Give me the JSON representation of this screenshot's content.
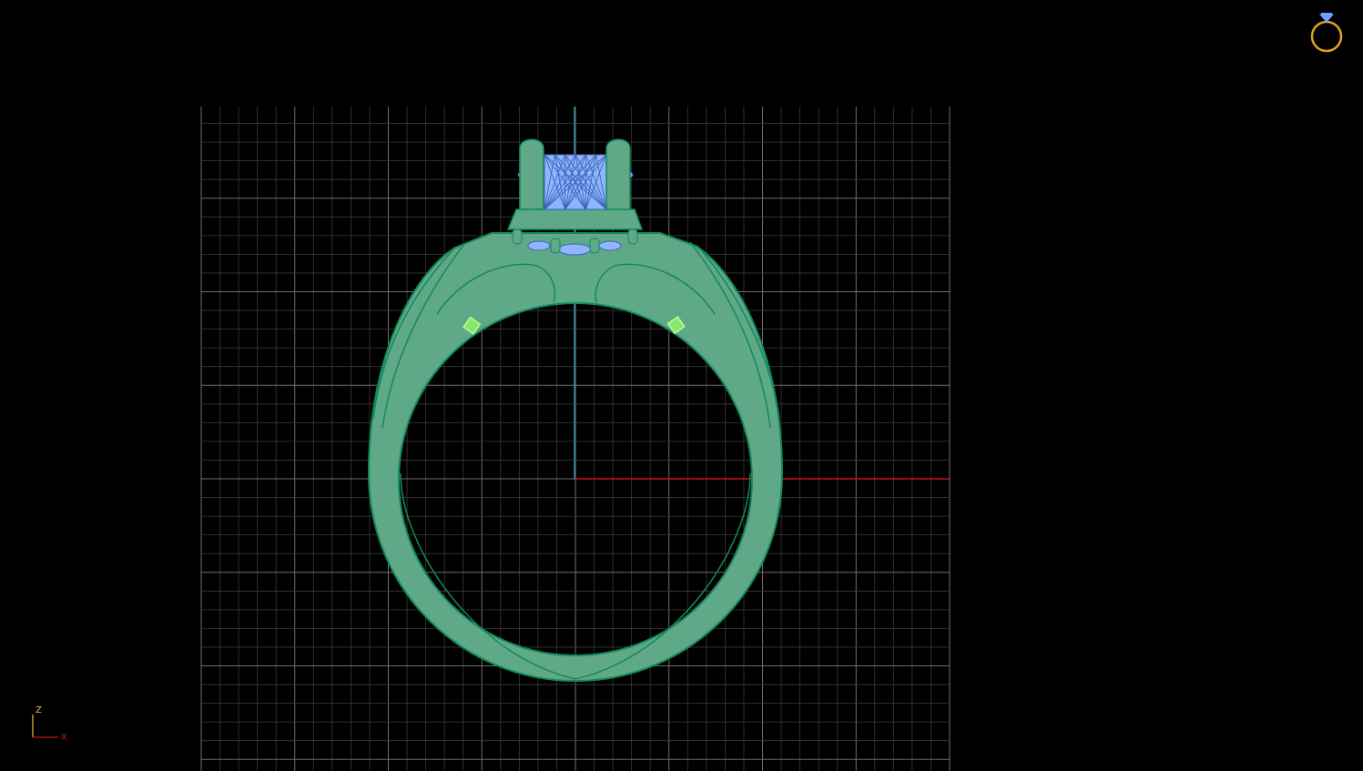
{
  "viewport": {
    "view": "front",
    "background": "#000000",
    "grid_color": "#6e6e6e",
    "grid_minor_color": "#3a3a3a"
  },
  "axes": {
    "vertical_axis_color": "#2aa7c9",
    "horizontal_axis_color": "#c81414"
  },
  "axis_indicator": {
    "up_label": "Z",
    "right_label": "X",
    "up_color": "#e8c23a",
    "right_color": "#c81414"
  },
  "model": {
    "object": "ring",
    "metal_color": "#5fa888",
    "metal_edge_color": "#138a5a",
    "gem_color": "#8fb5ff",
    "marker_color": "#86e86a"
  },
  "corner_icon": {
    "icon": "ring-icon",
    "ring_color": "#e0a020",
    "gem_color": "#6fa0ff"
  }
}
